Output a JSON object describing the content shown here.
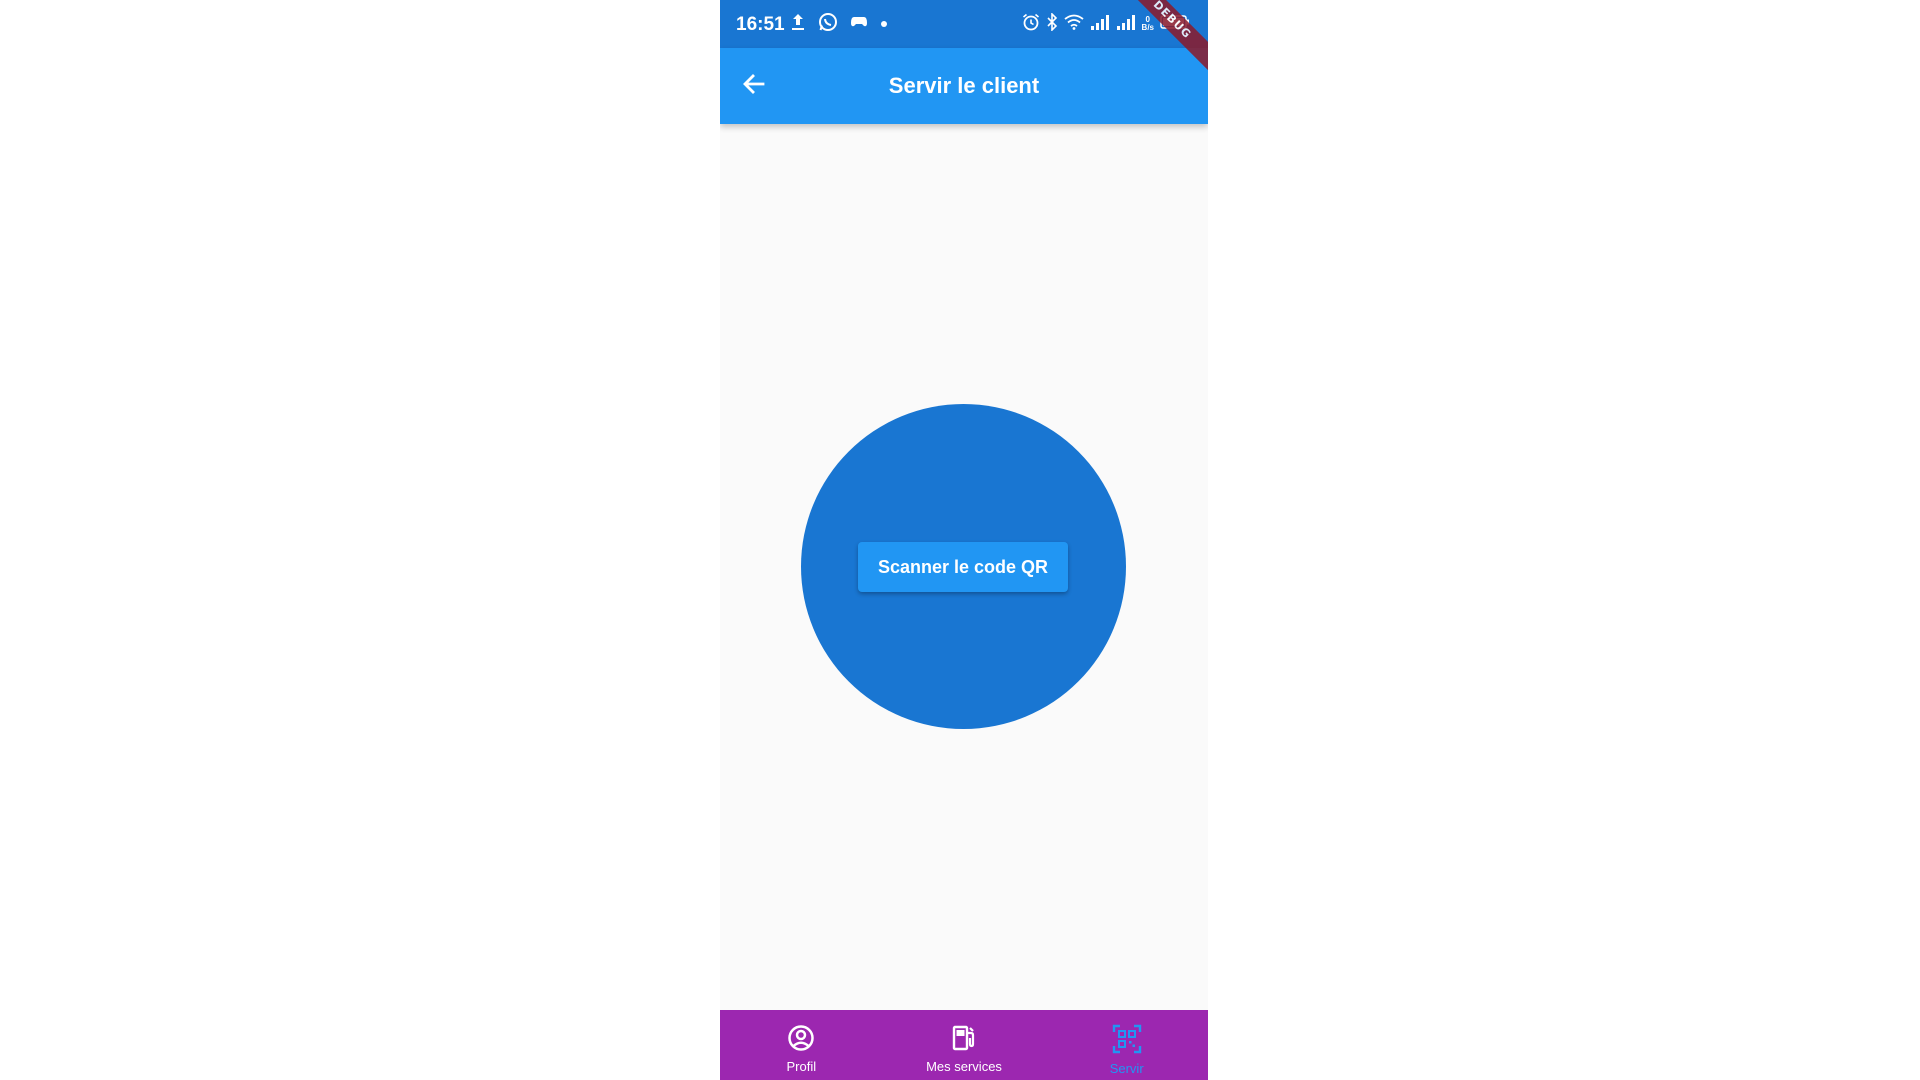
{
  "status_bar": {
    "time": "16:51",
    "speed_value": "0",
    "speed_unit": "B/s",
    "left_icons": [
      "upload-icon",
      "whatsapp-icon",
      "gamepad-icon",
      "dot-icon"
    ],
    "right_icons": [
      "alarm-icon",
      "bluetooth-icon",
      "wifi-icon",
      "signal-icon",
      "signal-icon",
      "battery-icon"
    ]
  },
  "debug_banner": "DEBUG",
  "app_bar": {
    "title": "Servir le client",
    "back_icon": "arrow-back-icon"
  },
  "main": {
    "scan_button_label": "Scanner le code QR"
  },
  "bottom_nav": {
    "items": [
      {
        "label": "Profil",
        "icon": "account-circle-icon",
        "active": false
      },
      {
        "label": "Mes services",
        "icon": "fuel-station-icon",
        "active": false
      },
      {
        "label": "Servir",
        "icon": "qr-scanner-icon",
        "active": true
      }
    ]
  },
  "colors": {
    "status_bar": "#1976d2",
    "app_bar": "#2196f3",
    "circle": "#1976d2",
    "button": "#2196f3",
    "bottom_nav": "#9c27b0",
    "nav_active": "#2196f3",
    "nav_inactive": "#ffffff",
    "debug_banner": "#8b1a2b"
  }
}
